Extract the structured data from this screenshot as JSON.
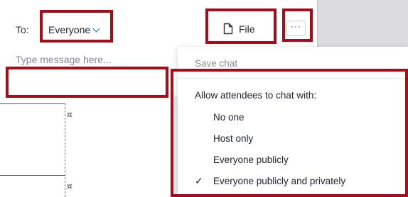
{
  "chat": {
    "to_label": "To:",
    "recipient": "Everyone",
    "file_label": "File",
    "more_label": "···",
    "message_placeholder": "Type message here..."
  },
  "menu": {
    "save_chat": "Save chat",
    "section_header": "Allow attendees to chat with:",
    "options": [
      {
        "label": "No one",
        "checked": false
      },
      {
        "label": "Host only",
        "checked": false
      },
      {
        "label": "Everyone publicly",
        "checked": false
      },
      {
        "label": "Everyone publicly and privately",
        "checked": true
      }
    ],
    "check_glyph": "✓"
  },
  "document": {
    "paragraph_mark": "¤"
  },
  "colors": {
    "highlight": "#a50e18",
    "accent": "#0e71eb"
  },
  "icons": [
    "chevron-down-icon",
    "file-icon",
    "more-icon",
    "checkmark-icon"
  ]
}
